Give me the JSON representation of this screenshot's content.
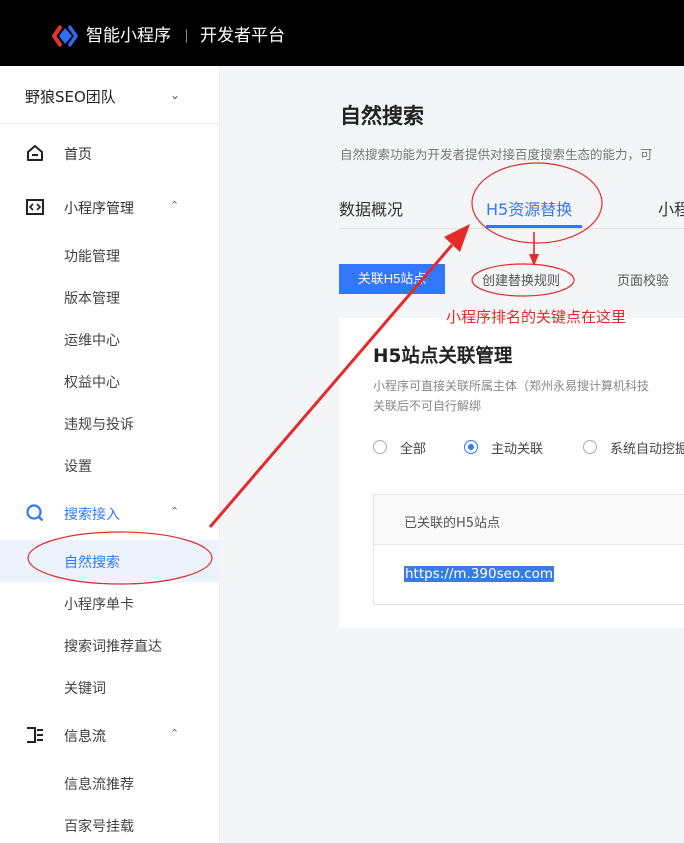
{
  "header": {
    "brand": "智能小程序",
    "subtitle": "开发者平台"
  },
  "sidebar": {
    "team": "野狼SEO团队",
    "items": [
      {
        "label": "首页"
      },
      {
        "label": "小程序管理"
      },
      {
        "label": "功能管理"
      },
      {
        "label": "版本管理"
      },
      {
        "label": "运维中心"
      },
      {
        "label": "权益中心"
      },
      {
        "label": "违规与投诉"
      },
      {
        "label": "设置"
      },
      {
        "label": "搜索接入"
      },
      {
        "label": "自然搜索"
      },
      {
        "label": "小程序单卡"
      },
      {
        "label": "搜索词推荐直达"
      },
      {
        "label": "关键词"
      },
      {
        "label": "信息流"
      },
      {
        "label": "信息流推荐"
      },
      {
        "label": "百家号挂载"
      }
    ]
  },
  "main": {
    "title": "自然搜索",
    "description": "自然搜索功能为开发者提供对接百度搜索生态的能力，可",
    "tabs": [
      {
        "label": "数据概况"
      },
      {
        "label": "H5资源替换"
      },
      {
        "label": "小程"
      }
    ],
    "buttons": {
      "link_h5": "关联H5站点"
    },
    "sub_tabs": [
      {
        "label": "创建替换规则"
      },
      {
        "label": "页面校验"
      }
    ],
    "card": {
      "title": "H5站点关联管理",
      "desc_line1": "小程序可直接关联所属主体（郑州永易搜计算机科技",
      "desc_line2": "关联后不可自行解绑",
      "radios": [
        {
          "label": "全部",
          "checked": false
        },
        {
          "label": "主动关联",
          "checked": true
        },
        {
          "label": "系统自动挖掘"
        }
      ],
      "table_header": "已关联的H5站点",
      "table_value": "https://m.390seo.com"
    }
  },
  "annotation": {
    "note": "小程序排名的关键点在这里",
    "color": "#e62a2a"
  },
  "colors": {
    "accent": "#3377ff",
    "topbar": "#000000"
  }
}
